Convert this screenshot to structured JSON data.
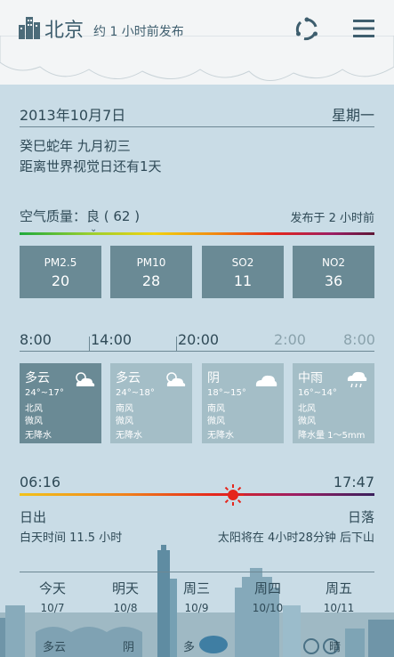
{
  "header": {
    "city": "北京",
    "publish_time": "约 1 小时前发布",
    "icons": [
      "city-icon",
      "refresh-icon",
      "menu-icon"
    ]
  },
  "date": {
    "date": "2013年10月7日",
    "weekday": "星期一",
    "lunar": "癸巳蛇年 九月初三",
    "holiday": "距离世界视觉日还有1天"
  },
  "air": {
    "label": "空气质量：良 ( 62 )",
    "published": "发布于 2 小时前",
    "pollutants": [
      {
        "name": "PM2.5",
        "value": "20"
      },
      {
        "name": "PM10",
        "value": "28"
      },
      {
        "name": "SO2",
        "value": "11"
      },
      {
        "name": "NO2",
        "value": "36"
      }
    ]
  },
  "timeline": {
    "labels": [
      "8:00",
      "14:00",
      "20:00",
      "2:00",
      "8:00"
    ]
  },
  "forecast": [
    {
      "cond": "多云",
      "temp": "24°~17°",
      "wind_dir": "北风",
      "wind_speed": "微风",
      "rain": "无降水",
      "icon": "partly-cloudy-icon"
    },
    {
      "cond": "多云",
      "temp": "24°~18°",
      "wind_dir": "南风",
      "wind_speed": "微风",
      "rain": "无降水",
      "icon": "partly-cloudy-icon"
    },
    {
      "cond": "阴",
      "temp": "18°~15°",
      "wind_dir": "南风",
      "wind_speed": "微风",
      "rain": "无降水",
      "icon": "cloud-icon"
    },
    {
      "cond": "中雨",
      "temp": "16°~14°",
      "wind_dir": "北风",
      "wind_speed": "微风",
      "rain": "降水量 1～5mm",
      "icon": "rain-icon"
    }
  ],
  "sun": {
    "sunrise_time": "06:16",
    "sunset_time": "17:47",
    "sunrise_label": "日出",
    "sunset_label": "日落",
    "daylight": "白天时间 11.5 小时",
    "sunset_in": "太阳将在 4小时28分钟 后下山"
  },
  "days": [
    {
      "name": "今天",
      "date": "10/7"
    },
    {
      "name": "明天",
      "date": "10/8"
    },
    {
      "name": "周三",
      "date": "10/9"
    },
    {
      "name": "周四",
      "date": "10/10"
    },
    {
      "name": "周五",
      "date": "10/11"
    }
  ],
  "bottom_strip": [
    "多云",
    "阴",
    "多",
    "晴"
  ],
  "colors": {
    "background": "#c9dce6",
    "card_dark": "#6a8a95",
    "card_light": "#a4bec7",
    "text": "#2f4a57"
  }
}
